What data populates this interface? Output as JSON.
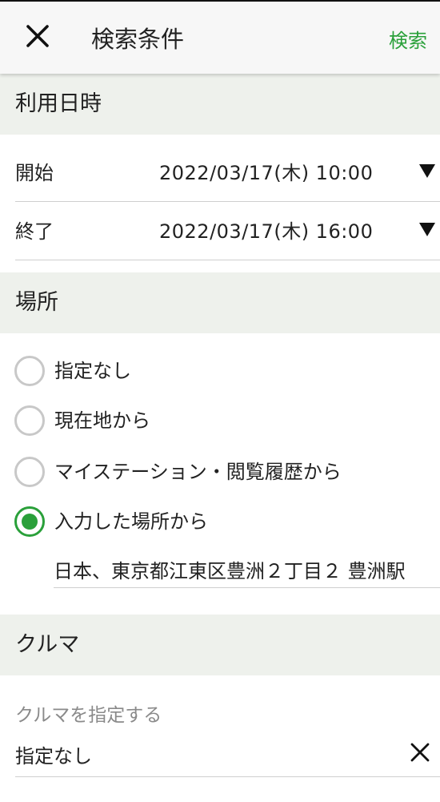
{
  "appbar": {
    "title": "検索条件",
    "action_label": "検索"
  },
  "datetime": {
    "header": "利用日時",
    "start": {
      "label": "開始",
      "value": "2022/03/17(木) 10:00"
    },
    "end": {
      "label": "終了",
      "value": "2022/03/17(木) 16:00"
    }
  },
  "place": {
    "header": "場所",
    "options": [
      {
        "label": "指定なし",
        "selected": false
      },
      {
        "label": "現在地から",
        "selected": false
      },
      {
        "label": "マイステーション・閲覧履歴から",
        "selected": false
      },
      {
        "label": "入力した場所から",
        "selected": true
      }
    ],
    "input_value": "日本、東京都江東区豊洲２丁目２ 豊洲駅"
  },
  "car": {
    "header": "クルマ",
    "hint": "クルマを指定する",
    "value": "指定なし"
  },
  "colors": {
    "accent": "#2aa03a",
    "section_bg": "#eef1ec"
  }
}
